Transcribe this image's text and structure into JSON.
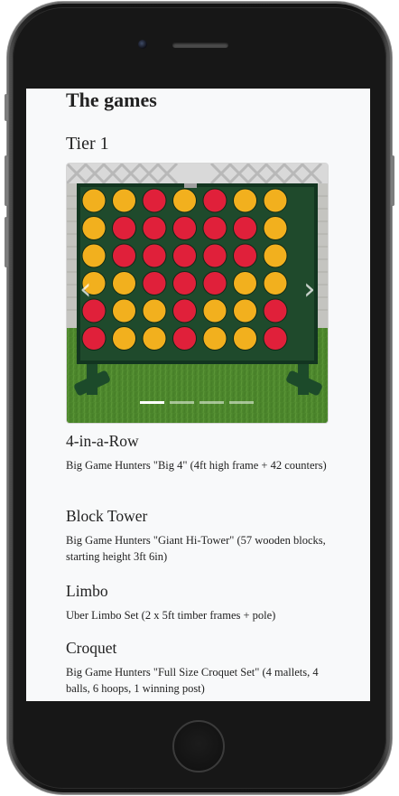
{
  "page": {
    "title": "The games",
    "tier_heading": "Tier 1"
  },
  "carousel": {
    "image": "giant-connect-four-game-icon",
    "slide_count": 4,
    "active_slide": 1,
    "prev_label": "‹",
    "next_label": "›"
  },
  "games": [
    {
      "title": "4-in-a-Row",
      "description": "Big Game Hunters \"Big 4\" (4ft high frame + 42 counters)"
    },
    {
      "title": "Block Tower",
      "description": "Big Game Hunters \"Giant Hi-Tower\" (57 wooden blocks, starting height 3ft 6in)"
    },
    {
      "title": "Limbo",
      "description": "Uber Limbo Set (2 x 5ft timber frames + pole)"
    },
    {
      "title": "Croquet",
      "description": "Big Game Hunters \"Full Size Croquet Set\" (4 mallets, 4 balls, 6 hoops, 1 winning post)"
    }
  ],
  "colors": {
    "board_green": "#1f4a2c",
    "counter_red": "#e0203a",
    "counter_yellow": "#f2b01e",
    "grass": "#4f8a2e",
    "screen_bg": "#f8f9fa"
  }
}
